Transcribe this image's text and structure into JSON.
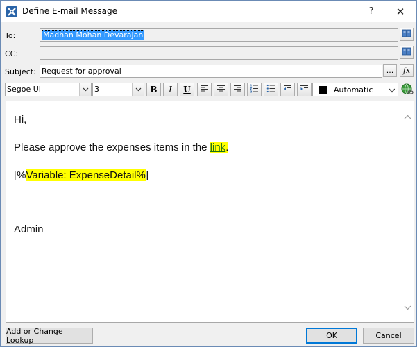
{
  "window": {
    "title": "Define E-mail Message",
    "help_label": "?",
    "close_label": "✕"
  },
  "fields": {
    "to_label": "To:",
    "to_value": "Madhan Mohan Devarajan",
    "cc_label": "CC:",
    "cc_value": "",
    "subject_label": "Subject:",
    "subject_value": "Request for approval",
    "ellipsis_label": "...",
    "fx_label": "fx"
  },
  "toolbar": {
    "font_name": "Segoe UI",
    "font_size": "3",
    "bold_label": "B",
    "italic_label": "I",
    "underline_label": "U",
    "color_label": "Automatic",
    "color_value": "#000000"
  },
  "editor": {
    "line1": "Hi,",
    "line2_prefix": "Please approve the expenses items in the ",
    "line2_link": "link",
    "line2_suffix": ".",
    "line3_open": "[%",
    "line3_variable": "Variable: ExpenseDetail%",
    "line3_close": "]",
    "signature": "Admin"
  },
  "buttons": {
    "lookup": "Add or Change Lookup",
    "ok": "OK",
    "cancel": "Cancel"
  },
  "colors": {
    "highlight": "#ffff00",
    "selection": "#3399ff",
    "accent": "#0078d7"
  }
}
